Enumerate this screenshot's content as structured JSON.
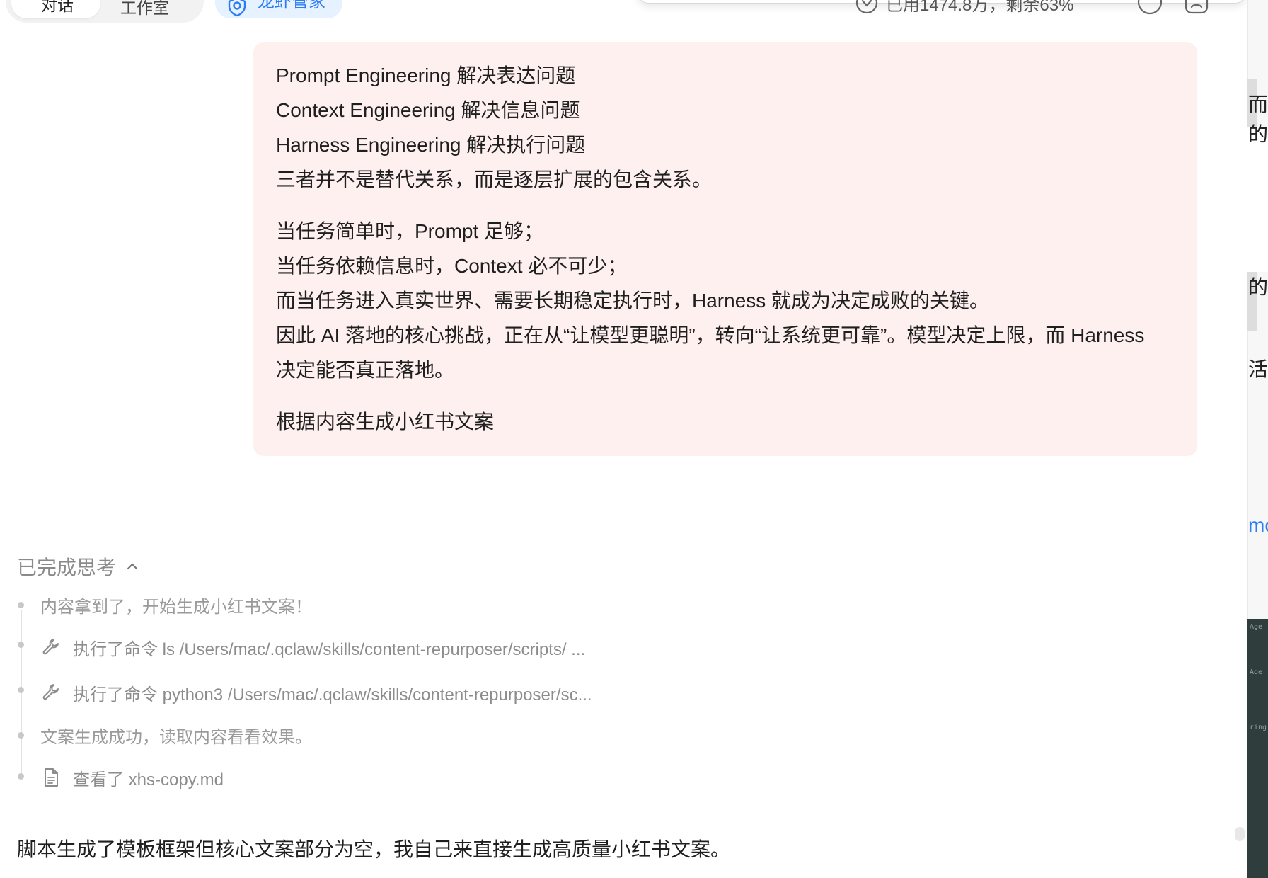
{
  "top_bar": {
    "tab_chat": "对话",
    "tab_studio": "工作室",
    "lobster_label": "龙虾管家",
    "usage_text": "已用1474.8万，剩余63%"
  },
  "message": {
    "lines": [
      "Prompt Engineering 解决表达问题",
      "Context Engineering 解决信息问题",
      "Harness Engineering 解决执行问题",
      "三者并不是替代关系，而是逐层扩展的包含关系。",
      "当任务简单时，Prompt 足够；",
      "当任务依赖信息时，Context 必不可少；",
      "而当任务进入真实世界、需要长期稳定执行时，Harness 就成为决定成败的关键。",
      "因此 AI 落地的核心挑战，正在从“让模型更聪明”，转向“让系统更可靠”。模型决定上限，而 Harness",
      "决定能否真正落地。",
      "根据内容生成小红书文案"
    ]
  },
  "thinking": {
    "header": "已完成思考",
    "steps": [
      "内容拿到了，开始生成小红书文案！",
      "执行了命令 ls /Users/mac/.qclaw/skills/content-repurposer/scripts/ ...",
      "执行了命令 python3 /Users/mac/.qclaw/skills/content-repurposer/sc...",
      "文案生成成功，读取内容看看效果。",
      "查看了 xhs-copy.md"
    ]
  },
  "reply": {
    "text": "脚本生成了模板框架但核心文案部分为空，我自己来直接生成高质量小红书文案。"
  },
  "side_panel": {
    "fragments": [
      "而是",
      "的",
      "的改",
      "活话",
      "mc"
    ],
    "ticks": [
      "Age",
      "Age",
      "ring"
    ]
  },
  "colors": {
    "bubble_bg": "#fff0f0",
    "accent_blue": "#2b7cf5",
    "muted_text": "#9a9a9a"
  }
}
